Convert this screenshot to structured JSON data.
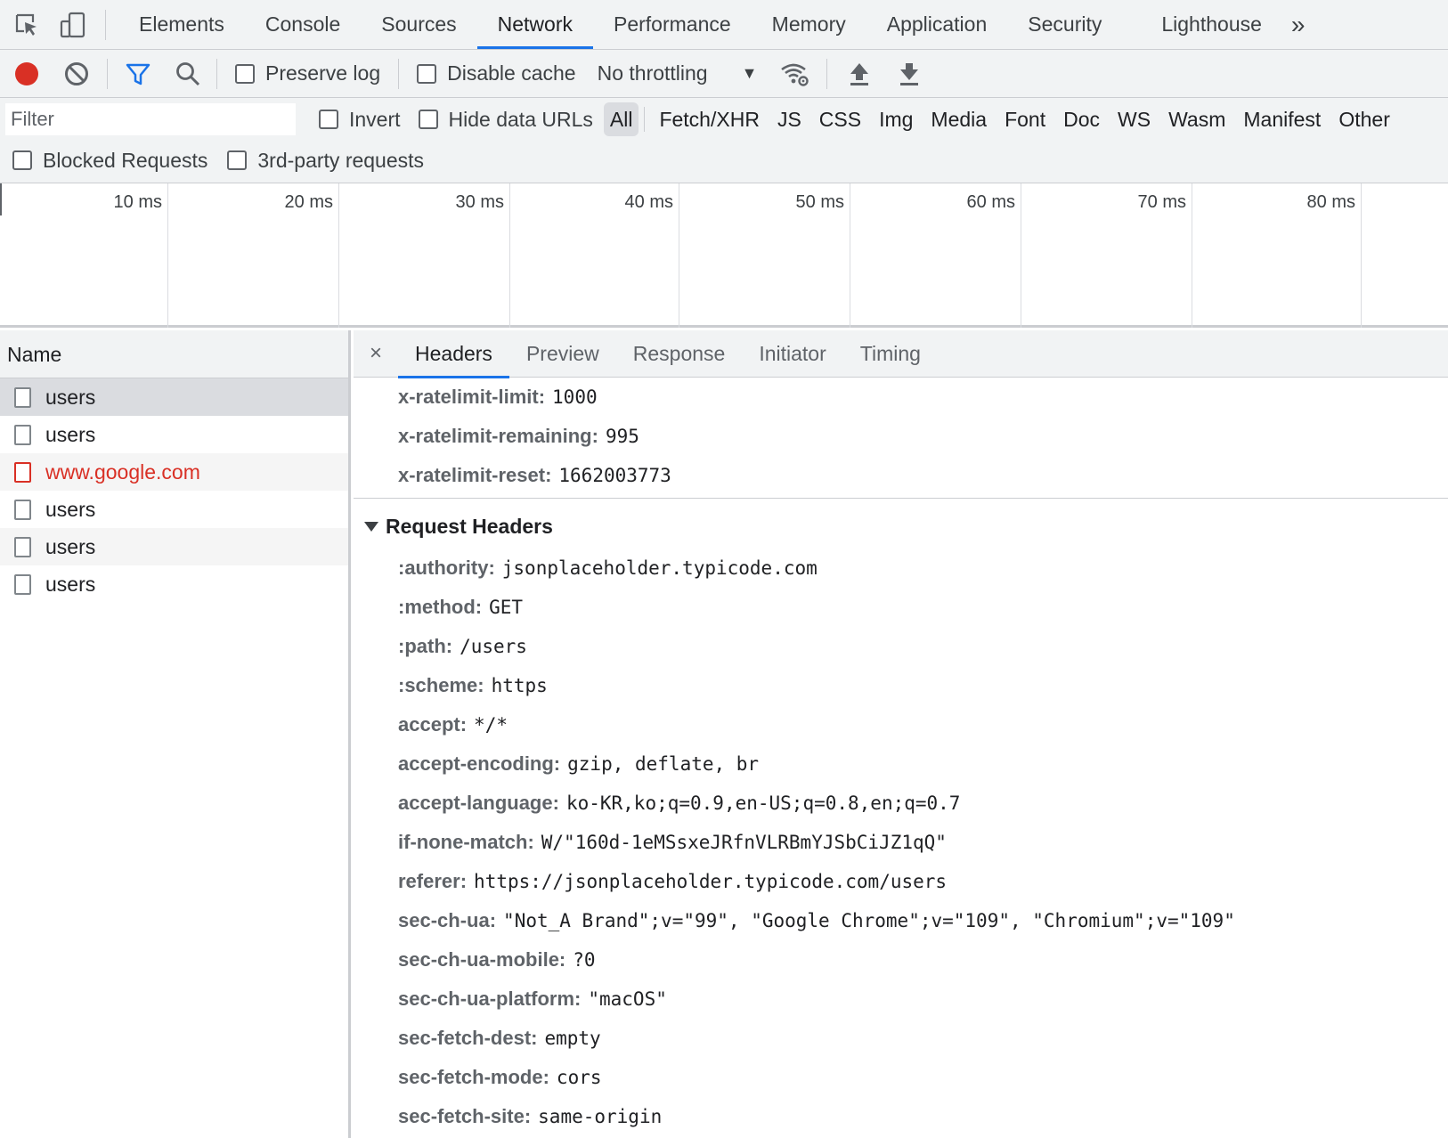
{
  "tabs": {
    "items": [
      "Elements",
      "Console",
      "Sources",
      "Network",
      "Performance",
      "Memory",
      "Application",
      "Security",
      "Lighthouse"
    ],
    "active": "Network",
    "more_glyph": "»"
  },
  "toolbar": {
    "preserve_log": "Preserve log",
    "disable_cache": "Disable cache",
    "throttling": "No throttling",
    "dropdown_glyph": "▼"
  },
  "filter": {
    "placeholder": "Filter",
    "invert": "Invert",
    "hide_data_urls": "Hide data URLs",
    "types": [
      "All",
      "Fetch/XHR",
      "JS",
      "CSS",
      "Img",
      "Media",
      "Font",
      "Doc",
      "WS",
      "Wasm",
      "Manifest",
      "Other"
    ],
    "active_type": "All",
    "blocked_requests": "Blocked Requests",
    "third_party": "3rd-party requests"
  },
  "timeline": {
    "ticks": [
      "10 ms",
      "20 ms",
      "30 ms",
      "40 ms",
      "50 ms",
      "60 ms",
      "70 ms",
      "80 ms"
    ]
  },
  "requests": {
    "header": "Name",
    "items": [
      {
        "name": "users",
        "status": "ok"
      },
      {
        "name": "users",
        "status": "ok"
      },
      {
        "name": "www.google.com",
        "status": "error"
      },
      {
        "name": "users",
        "status": "ok"
      },
      {
        "name": "users",
        "status": "ok"
      },
      {
        "name": "users",
        "status": "ok"
      }
    ]
  },
  "details": {
    "close_glyph": "×",
    "tabs": [
      "Headers",
      "Preview",
      "Response",
      "Initiator",
      "Timing"
    ],
    "active_tab": "Headers",
    "response_headers_tail": [
      {
        "key": "x-ratelimit-limit:",
        "value": "1000"
      },
      {
        "key": "x-ratelimit-remaining:",
        "value": "995"
      },
      {
        "key": "x-ratelimit-reset:",
        "value": "1662003773"
      }
    ],
    "request_section_title": "Request Headers",
    "request_headers": [
      {
        "key": ":authority:",
        "value": "jsonplaceholder.typicode.com"
      },
      {
        "key": ":method:",
        "value": "GET"
      },
      {
        "key": ":path:",
        "value": "/users"
      },
      {
        "key": ":scheme:",
        "value": "https"
      },
      {
        "key": "accept:",
        "value": "*/*"
      },
      {
        "key": "accept-encoding:",
        "value": "gzip, deflate, br"
      },
      {
        "key": "accept-language:",
        "value": "ko-KR,ko;q=0.9,en-US;q=0.8,en;q=0.7"
      },
      {
        "key": "if-none-match:",
        "value": "W/\"160d-1eMSsxeJRfnVLRBmYJSbCiJZ1qQ\""
      },
      {
        "key": "referer:",
        "value": "https://jsonplaceholder.typicode.com/users"
      },
      {
        "key": "sec-ch-ua:",
        "value": "\"Not_A Brand\";v=\"99\", \"Google Chrome\";v=\"109\", \"Chromium\";v=\"109\""
      },
      {
        "key": "sec-ch-ua-mobile:",
        "value": "?0"
      },
      {
        "key": "sec-ch-ua-platform:",
        "value": "\"macOS\""
      },
      {
        "key": "sec-fetch-dest:",
        "value": "empty"
      },
      {
        "key": "sec-fetch-mode:",
        "value": "cors"
      },
      {
        "key": "sec-fetch-site:",
        "value": "same-origin"
      }
    ]
  },
  "colors": {
    "accent": "#1a73e8",
    "record": "#d93025",
    "error_text": "#d93025"
  }
}
